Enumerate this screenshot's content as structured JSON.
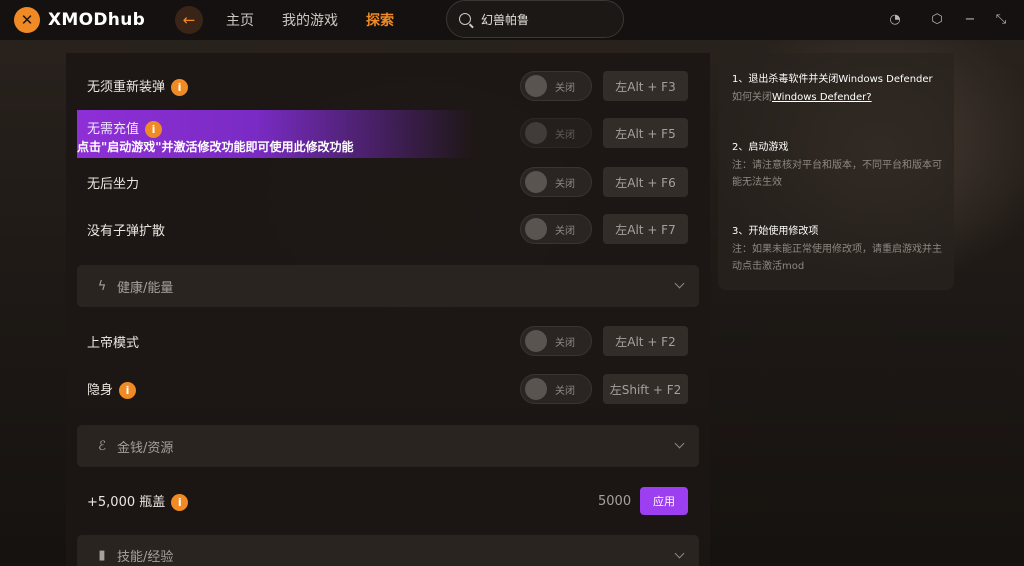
{
  "app": {
    "logo_text": "XMODhub",
    "logo_icon": "xmod-logo-icon"
  },
  "nav": {
    "home": "主页",
    "my_games": "我的游戏",
    "explore": "探索"
  },
  "search": {
    "value": "幻兽帕鲁"
  },
  "rows": {
    "no_reload": {
      "label": "无须重新装弹",
      "toggle": "关闭",
      "hotkey": "左Alt + F3"
    },
    "no_recharge": {
      "label": "无需充值",
      "toggle": "关闭",
      "hotkey": "左Alt + F5"
    },
    "no_recoil": {
      "label": "无后坐力",
      "toggle": "关闭",
      "hotkey": "左Alt + F6"
    },
    "no_spread": {
      "label": "没有子弹扩散",
      "toggle": "关闭",
      "hotkey": "左Alt + F7"
    },
    "god_mode": {
      "label": "上帝模式",
      "toggle": "关闭",
      "hotkey": "左Alt + F2"
    },
    "stealth": {
      "label": "隐身",
      "toggle": "关闭",
      "hotkey": "左Shift + F2"
    },
    "bottle_caps": {
      "label": "+5,000 瓶盖",
      "value": "5000",
      "button": "应用"
    }
  },
  "promo": {
    "text": "点击\"启动游戏\"并激活修改功能即可使用此修改功能"
  },
  "sections": {
    "health": "健康/能量",
    "money": "金钱/资源",
    "skills": "技能/经验"
  },
  "guide": {
    "step1_title": "1、退出杀毒软件并关闭Windows Defender",
    "step1_note_prefix": "如何关闭",
    "step1_link": "Windows Defender?",
    "step2_title": "2、启动游戏",
    "step2_note": "注：请注意核对平台和版本，不同平台和版本可能无法生效",
    "step3_title": "3、开始使用修改项",
    "step3_note": "注：如果未能正常使用修改项，请重启游戏并主动点击激活mod"
  },
  "colors": {
    "accent": "#f08a24",
    "purple": "#9b3ff0"
  }
}
